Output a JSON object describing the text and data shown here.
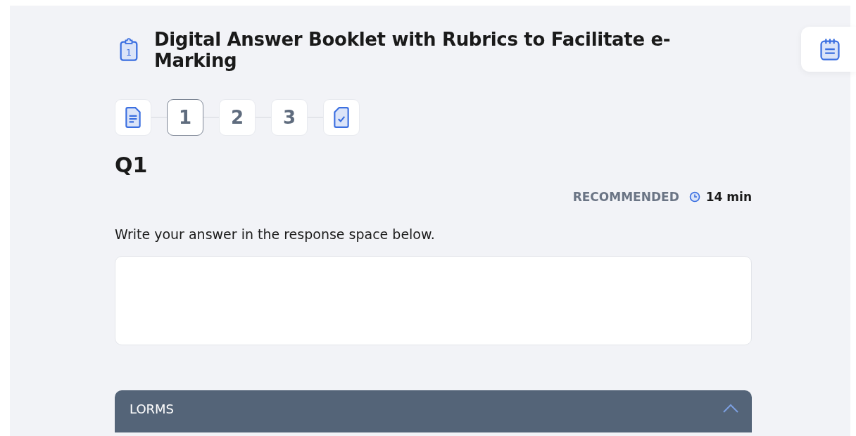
{
  "header": {
    "title": "Digital Answer Booklet with Rubrics to Facilitate e-Marking",
    "icon_number": "1"
  },
  "steps": [
    {
      "kind": "instructions",
      "selected": false
    },
    {
      "kind": "question",
      "label": "1",
      "selected": true
    },
    {
      "kind": "question",
      "label": "2",
      "selected": false
    },
    {
      "kind": "question",
      "label": "3",
      "selected": false
    },
    {
      "kind": "review",
      "selected": false
    }
  ],
  "question": {
    "title": "Q1",
    "recommended_label": "RECOMMENDED",
    "recommended_time": "14 min",
    "instruction": "Write your answer in the response space below."
  },
  "accordion": {
    "title": "LORMS",
    "expanded": true
  }
}
